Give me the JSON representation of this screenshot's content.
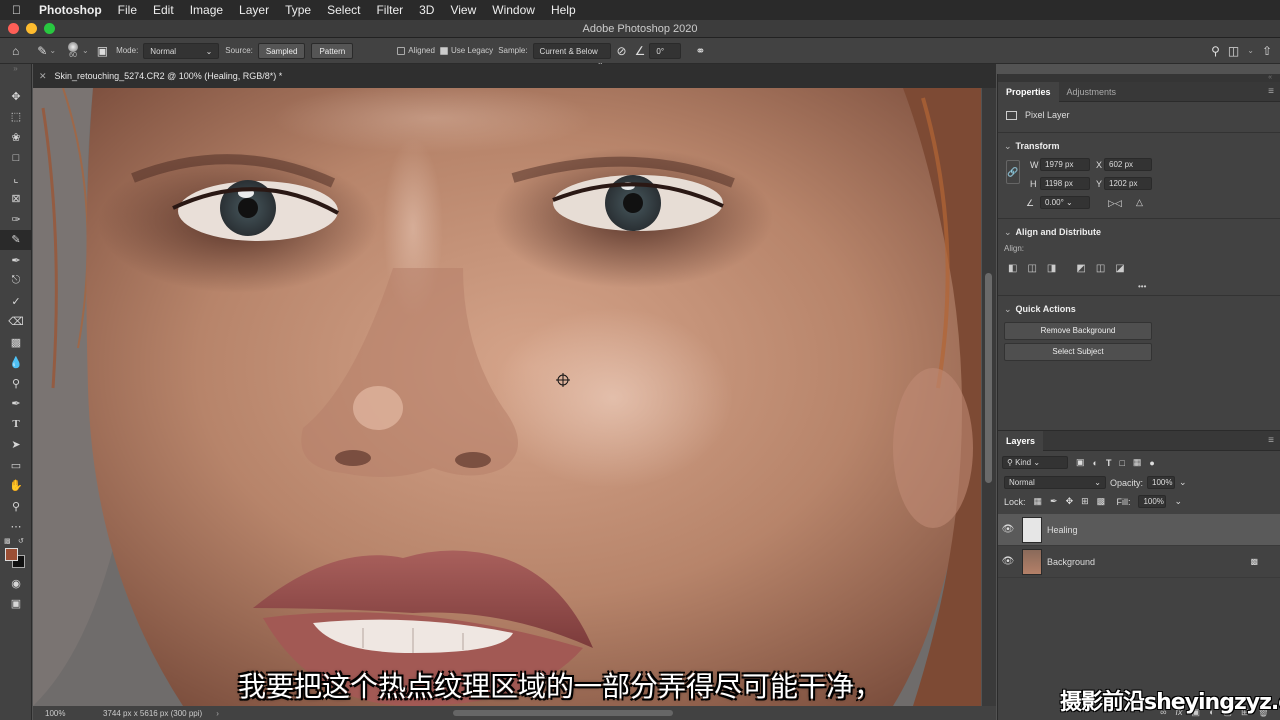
{
  "menubar": {
    "app": "Photoshop",
    "items": [
      "File",
      "Edit",
      "Image",
      "Layer",
      "Type",
      "Select",
      "Filter",
      "3D",
      "View",
      "Window",
      "Help"
    ]
  },
  "window": {
    "title": "Adobe Photoshop 2020"
  },
  "options": {
    "brush_size": "60",
    "mode_label": "Mode:",
    "mode_value": "Normal",
    "source_label": "Source:",
    "source_sampled": "Sampled",
    "source_pattern": "Pattern",
    "aligned_label": "Aligned",
    "legacy_label": "Use Legacy",
    "sample_label": "Sample:",
    "sample_value": "Current & Below",
    "angle_value": "0°"
  },
  "document": {
    "tab_title": "Skin_retouching_5274.CR2 @ 100% (Healing, RGB/8*) *",
    "zoom": "100%",
    "doc_info": "3744 px x 5616 px (300 ppi)"
  },
  "properties": {
    "tab_properties": "Properties",
    "tab_adjustments": "Adjustments",
    "layer_kind": "Pixel Layer",
    "transform_title": "Transform",
    "w_label": "W",
    "w_value": "1979 px",
    "h_label": "H",
    "h_value": "1198 px",
    "x_label": "X",
    "x_value": "602 px",
    "y_label": "Y",
    "y_value": "1202 px",
    "angle": "0.00°",
    "align_title": "Align and Distribute",
    "align_label": "Align:",
    "more": "•••",
    "quick_title": "Quick Actions",
    "remove_bg": "Remove Background",
    "select_subject": "Select Subject"
  },
  "layers_panel": {
    "title": "Layers",
    "filter_kind": "Kind",
    "blend_mode": "Normal",
    "opacity_label": "Opacity:",
    "opacity_value": "100%",
    "lock_label": "Lock:",
    "fill_label": "Fill:",
    "fill_value": "100%",
    "layers": [
      {
        "name": "Healing"
      },
      {
        "name": "Background"
      }
    ]
  },
  "overlay": {
    "subtitle": "我要把这个热点纹理区域的一部分弄得尽可能干净，",
    "watermark": "摄影前沿sheyingzyz.com"
  },
  "colors": {
    "foreground": "#9b4f35",
    "background": "#111111"
  }
}
